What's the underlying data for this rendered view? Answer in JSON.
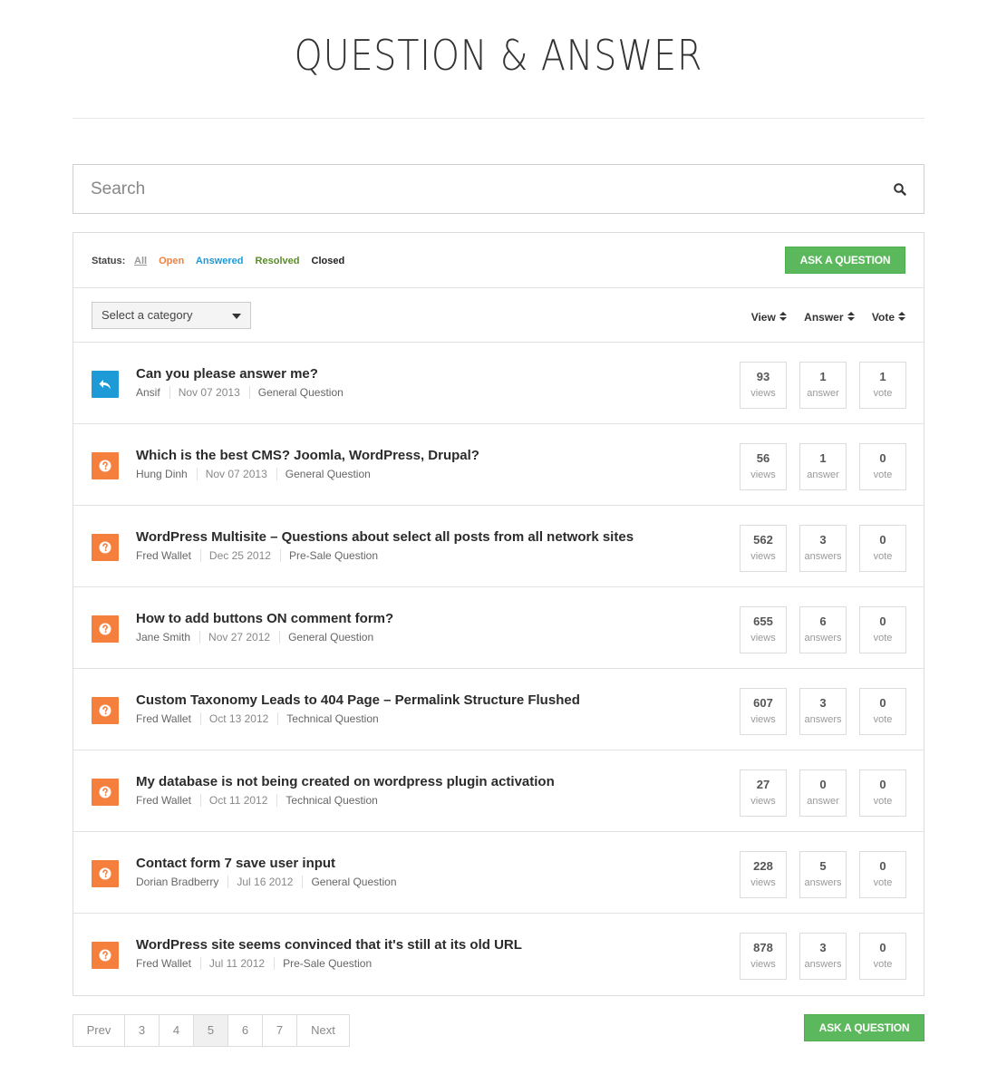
{
  "page": {
    "title": "QUESTION & ANSWER"
  },
  "search": {
    "placeholder": "Search"
  },
  "status": {
    "label": "Status:",
    "filters": [
      "All",
      "Open",
      "Answered",
      "Resolved",
      "Closed"
    ]
  },
  "ask_button_label": "ASK A QUESTION",
  "category": {
    "selected": "Select a category"
  },
  "sort": {
    "view": "View",
    "answer": "Answer",
    "vote": "Vote"
  },
  "colors": {
    "answered": "#1e9ad6",
    "open": "#f5803e",
    "resolved": "#5b8c2a",
    "button": "#5cb85c"
  },
  "questions": [
    {
      "status": "answered",
      "icon": "reply-icon",
      "title": "Can you please answer me?",
      "author": "Ansif",
      "date": "Nov 07 2013",
      "category": "General Question",
      "views": "93",
      "views_label": "views",
      "answers": "1",
      "answers_label": "answer",
      "votes": "1",
      "votes_label": "vote"
    },
    {
      "status": "open",
      "icon": "question-icon",
      "title": "Which is the best CMS? Joomla, WordPress, Drupal?",
      "author": "Hung Dinh",
      "date": "Nov 07 2013",
      "category": "General Question",
      "views": "56",
      "views_label": "views",
      "answers": "1",
      "answers_label": "answer",
      "votes": "0",
      "votes_label": "vote"
    },
    {
      "status": "open",
      "icon": "question-icon",
      "title": "WordPress Multisite – Questions about select all posts from all network sites",
      "author": "Fred Wallet",
      "date": "Dec 25 2012",
      "category": "Pre-Sale Question",
      "views": "562",
      "views_label": "views",
      "answers": "3",
      "answers_label": "answers",
      "votes": "0",
      "votes_label": "vote"
    },
    {
      "status": "open",
      "icon": "question-icon",
      "title": "How to add buttons ON comment form?",
      "author": "Jane Smith",
      "date": "Nov 27 2012",
      "category": "General Question",
      "views": "655",
      "views_label": "views",
      "answers": "6",
      "answers_label": "answers",
      "votes": "0",
      "votes_label": "vote"
    },
    {
      "status": "open",
      "icon": "question-icon",
      "title": "Custom Taxonomy Leads to 404 Page – Permalink Structure Flushed",
      "author": "Fred Wallet",
      "date": "Oct 13 2012",
      "category": "Technical Question",
      "views": "607",
      "views_label": "views",
      "answers": "3",
      "answers_label": "answers",
      "votes": "0",
      "votes_label": "vote"
    },
    {
      "status": "open",
      "icon": "question-icon",
      "title": "My database is not being created on wordpress plugin activation",
      "author": "Fred Wallet",
      "date": "Oct 11 2012",
      "category": "Technical Question",
      "views": "27",
      "views_label": "views",
      "answers": "0",
      "answers_label": "answer",
      "votes": "0",
      "votes_label": "vote"
    },
    {
      "status": "open",
      "icon": "question-icon",
      "title": "Contact form 7 save user input",
      "author": "Dorian Bradberry",
      "date": "Jul 16 2012",
      "category": "General Question",
      "views": "228",
      "views_label": "views",
      "answers": "5",
      "answers_label": "answers",
      "votes": "0",
      "votes_label": "vote"
    },
    {
      "status": "open",
      "icon": "question-icon",
      "title": "WordPress site seems convinced that it's still at its old URL",
      "author": "Fred Wallet",
      "date": "Jul 11 2012",
      "category": "Pre-Sale Question",
      "views": "878",
      "views_label": "views",
      "answers": "3",
      "answers_label": "answers",
      "votes": "0",
      "votes_label": "vote"
    }
  ],
  "pagination": {
    "prev": "Prev",
    "pages": [
      "3",
      "4",
      "5",
      "6",
      "7"
    ],
    "current": "5",
    "next": "Next"
  }
}
